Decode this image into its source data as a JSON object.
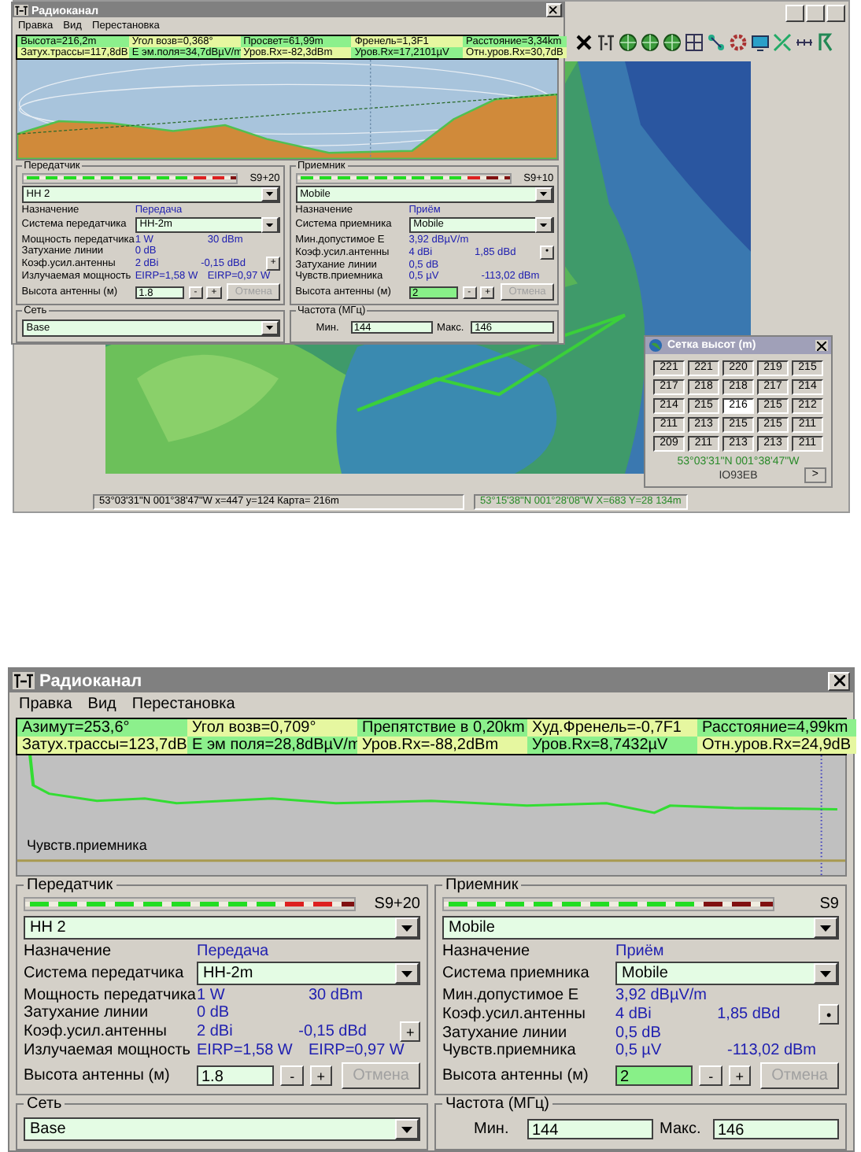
{
  "windows": [
    {
      "title": "Радиоканал",
      "menu": [
        "Правка",
        "Вид",
        "Перестановка"
      ],
      "info": [
        [
          "Высота=216,2m",
          "Угол возв=0,368°",
          "Просвет=61,99m",
          "Френель=1,3F1",
          "Расстояние=3,34km"
        ],
        [
          "Затух.трассы=117,8dB",
          "Е эм.поля=34,7dBµV/m",
          "Уров.Rx=-82,3dBm",
          "Уров.Rx=17,2101µV",
          "Отн.уров.Rx=30,7dB"
        ]
      ],
      "profile": {
        "kind": "terrain"
      },
      "transmitter": {
        "title": "Передатчик",
        "meter": {
          "level": 0.92
        },
        "reading": "S9+20",
        "device": "HH 2",
        "rows": [
          {
            "kind": "text",
            "label": "Назначение",
            "values": [
              "Передача"
            ]
          },
          {
            "kind": "select",
            "label": "Система передатчика",
            "value": "HH-2m"
          },
          {
            "kind": "text",
            "label": "Мощность передатчика",
            "values": [
              "1 W",
              "30 dBm"
            ]
          },
          {
            "kind": "text",
            "label": "Затухание линии",
            "values": [
              "0 dB"
            ]
          },
          {
            "kind": "text",
            "label": "Коэф.усил.антенны",
            "values": [
              "2 dBi",
              "-0,15 dBd"
            ],
            "button": "+"
          },
          {
            "kind": "text",
            "label": "Излучаемая мощность",
            "values": [
              "EIRP=1,58 W",
              "EIRP=0,97 W"
            ]
          },
          {
            "kind": "height",
            "label": "Высота антенны (м)",
            "value": "1.8",
            "highlighted": false,
            "buttons": [
              "-",
              "+"
            ],
            "cancel": {
              "label": "Отмена",
              "disabled": true
            }
          }
        ]
      },
      "receiver": {
        "title": "Приемник",
        "meter": {
          "level": 0.83
        },
        "reading": "S9+10",
        "device": "Mobile",
        "rows": [
          {
            "kind": "text",
            "label": "Назначение",
            "values": [
              "Приём"
            ]
          },
          {
            "kind": "select",
            "label": "Система приемника",
            "value": "Mobile"
          },
          {
            "kind": "text",
            "label": "Мин.допустимое E",
            "values": [
              "3,92 dBµV/m"
            ]
          },
          {
            "kind": "text",
            "label": "Коэф.усил.антенны",
            "values": [
              "4 dBi",
              "1,85 dBd"
            ],
            "button": "•"
          },
          {
            "kind": "text",
            "label": "Затухание линии",
            "values": [
              "0,5 dB"
            ]
          },
          {
            "kind": "text",
            "label": "Чувств.приемника",
            "values": [
              "0,5 µV",
              "-113,02 dBm"
            ]
          },
          {
            "kind": "height",
            "label": "Высота антенны (м)",
            "value": "2",
            "highlighted": true,
            "buttons": [
              "-",
              "+"
            ],
            "cancel": {
              "label": "Отмена",
              "disabled": true
            }
          }
        ]
      },
      "network": {
        "title": "Сеть",
        "value": "Base"
      },
      "frequency": {
        "title": "Частота (МГц)",
        "min_label": "Мин.",
        "min": "144",
        "max_label": "Макс.",
        "max": "146"
      }
    },
    {
      "title": "Радиоканал",
      "menu": [
        "Правка",
        "Вид",
        "Перестановка"
      ],
      "info": [
        [
          "Азимут=253,6°",
          "Угол возв=0,709°",
          "Препятствие в 0,20km",
          "Худ.Френель=-0,7F1",
          "Расстояние=4,99km"
        ],
        [
          "Затух.трассы=123,7dB",
          "Е эм поля=28,8dBµV/m",
          "Уров.Rx=-88,2dBm",
          "Уров.Rx=8,7432µV",
          "Отн.уров.Rx=24,9dB"
        ]
      ],
      "profile": {
        "kind": "line",
        "label": "Чувств.приемника"
      },
      "transmitter": {
        "title": "Передатчик",
        "meter": {
          "level": 0.92
        },
        "reading": "S9+20",
        "device": "HH 2",
        "rows": [
          {
            "kind": "text",
            "label": "Назначение",
            "values": [
              "Передача"
            ]
          },
          {
            "kind": "select",
            "label": "Система передатчика",
            "value": "HH-2m"
          },
          {
            "kind": "text",
            "label": "Мощность передатчика",
            "values": [
              "1 W",
              "30 dBm"
            ]
          },
          {
            "kind": "text",
            "label": "Затухание линии",
            "values": [
              "0 dB"
            ]
          },
          {
            "kind": "text",
            "label": "Коэф.усил.антенны",
            "values": [
              "2 dBi",
              "-0,15 dBd"
            ],
            "button": "+"
          },
          {
            "kind": "text",
            "label": "Излучаемая мощность",
            "values": [
              "EIRP=1,58 W",
              "EIRP=0,97 W"
            ]
          },
          {
            "kind": "height",
            "label": "Высота антенны (м)",
            "value": "1.8",
            "highlighted": false,
            "buttons": [
              "-",
              "+"
            ],
            "cancel": {
              "label": "Отмена",
              "disabled": true
            }
          }
        ]
      },
      "receiver": {
        "title": "Приемник",
        "meter": {
          "level": 0.75
        },
        "reading": "S9",
        "device": "Mobile",
        "rows": [
          {
            "kind": "text",
            "label": "Назначение",
            "values": [
              "Приём"
            ]
          },
          {
            "kind": "select",
            "label": "Система приемника",
            "value": "Mobile"
          },
          {
            "kind": "text",
            "label": "Мин.допустимое E",
            "values": [
              "3,92 dBµV/m"
            ]
          },
          {
            "kind": "text",
            "label": "Коэф.усил.антенны",
            "values": [
              "4 dBi",
              "1,85 dBd"
            ],
            "button": "•"
          },
          {
            "kind": "text",
            "label": "Затухание линии",
            "values": [
              "0,5 dB"
            ]
          },
          {
            "kind": "text",
            "label": "Чувств.приемника",
            "values": [
              "0,5 µV",
              "-113,02 dBm"
            ]
          },
          {
            "kind": "height",
            "label": "Высота антенны (м)",
            "value": "2",
            "highlighted": true,
            "buttons": [
              "-",
              "+"
            ],
            "cancel": {
              "label": "Отмена",
              "disabled": true
            }
          }
        ]
      },
      "network": {
        "title": "Сеть",
        "value": "Base"
      },
      "frequency": {
        "title": "Частота (МГц)",
        "min_label": "Мин.",
        "min": "144",
        "max_label": "Макс.",
        "max": "146"
      }
    }
  ],
  "heights_window": {
    "title": "Сетка высот (m)",
    "cells": [
      [
        {
          "value": "221",
          "selected": false
        },
        {
          "value": "221",
          "selected": false
        },
        {
          "value": "220",
          "selected": false
        },
        {
          "value": "219",
          "selected": false
        },
        {
          "value": "215",
          "selected": false
        }
      ],
      [
        {
          "value": "217",
          "selected": false
        },
        {
          "value": "218",
          "selected": false
        },
        {
          "value": "218",
          "selected": false
        },
        {
          "value": "217",
          "selected": false
        },
        {
          "value": "214",
          "selected": false
        }
      ],
      [
        {
          "value": "214",
          "selected": false
        },
        {
          "value": "215",
          "selected": false
        },
        {
          "value": "216",
          "selected": true
        },
        {
          "value": "215",
          "selected": false
        },
        {
          "value": "212",
          "selected": false
        }
      ],
      [
        {
          "value": "211",
          "selected": false
        },
        {
          "value": "213",
          "selected": false
        },
        {
          "value": "215",
          "selected": false
        },
        {
          "value": "215",
          "selected": false
        },
        {
          "value": "211",
          "selected": false
        }
      ],
      [
        {
          "value": "209",
          "selected": false
        },
        {
          "value": "211",
          "selected": false
        },
        {
          "value": "213",
          "selected": false
        },
        {
          "value": "213",
          "selected": false
        },
        {
          "value": "211",
          "selected": false
        }
      ]
    ],
    "coords": "53°03'31\"N 001°38'47\"W",
    "locator": "IO93EB",
    "next_button": ">"
  },
  "status_bar": [
    "53°03'31\"N 001°38'47\"W   x=447 y=124 Карта= 216m",
    "53°15'38\"N 001°28'08\"W X=683 Y=28 134m"
  ]
}
